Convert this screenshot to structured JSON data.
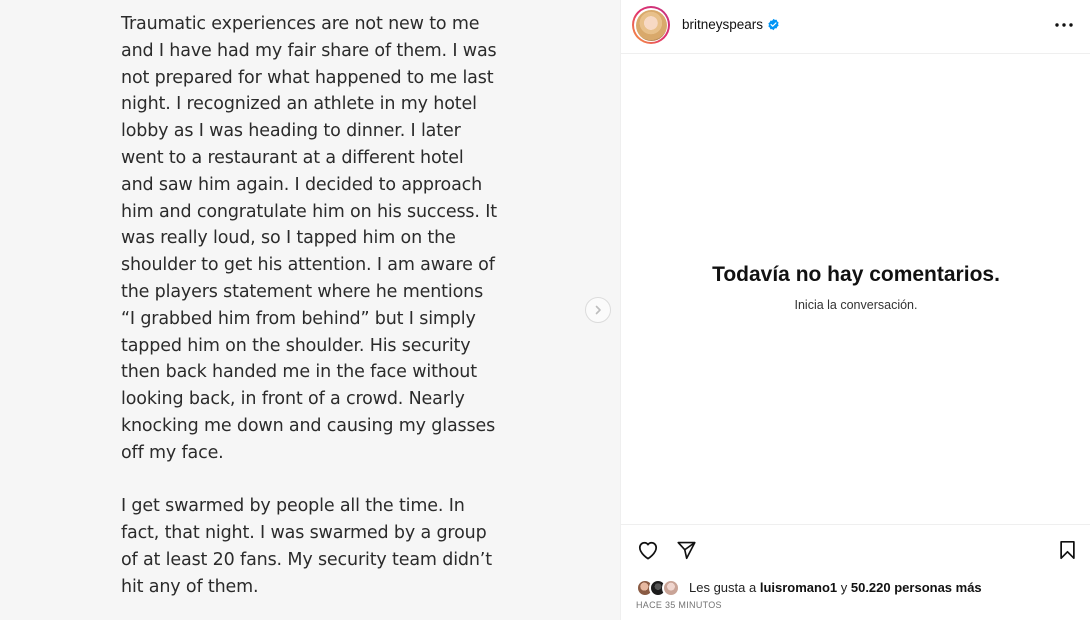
{
  "post": {
    "paragraphs": [
      "Traumatic experiences are not new to me and I have had my fair share of them. I was not prepared for what happened to me last night. I recognized an athlete in my hotel lobby as I was heading to dinner.  I later went to a restaurant at a different hotel and saw him again. I decided to approach him and congratulate him on his success. It was really loud, so I tapped him on the shoulder to get his attention. I am aware of the players statement where he mentions “I grabbed him from behind” but I simply tapped him on the shoulder. His security then back handed me in the face without looking back, in front of a crowd.  Nearly knocking me down and causing my glasses off my face.",
      "I get swarmed by people all the time. In fact, that night. I was swarmed by a group of at least 20 fans. My security team didn’t hit any of them."
    ]
  },
  "header": {
    "username": "britneyspears",
    "verified_icon": "verified-badge-icon",
    "more_icon": "more-options-icon"
  },
  "comments": {
    "empty_title": "Todavía no hay comentarios.",
    "empty_subtitle": "Inicia la conversación."
  },
  "actions": {
    "like_icon": "heart-icon",
    "share_icon": "paper-plane-icon",
    "save_icon": "bookmark-icon"
  },
  "likes": {
    "prefix": "Les gusta a ",
    "user": "luisromano1",
    "middle": " y ",
    "count": "50.220 personas más"
  },
  "timestamp": "HACE 35 MINUTOS",
  "colors": {
    "verified": "#0095f6",
    "left_pane_bg": "#f6f6f6",
    "post_text": "#2b2b2b"
  }
}
